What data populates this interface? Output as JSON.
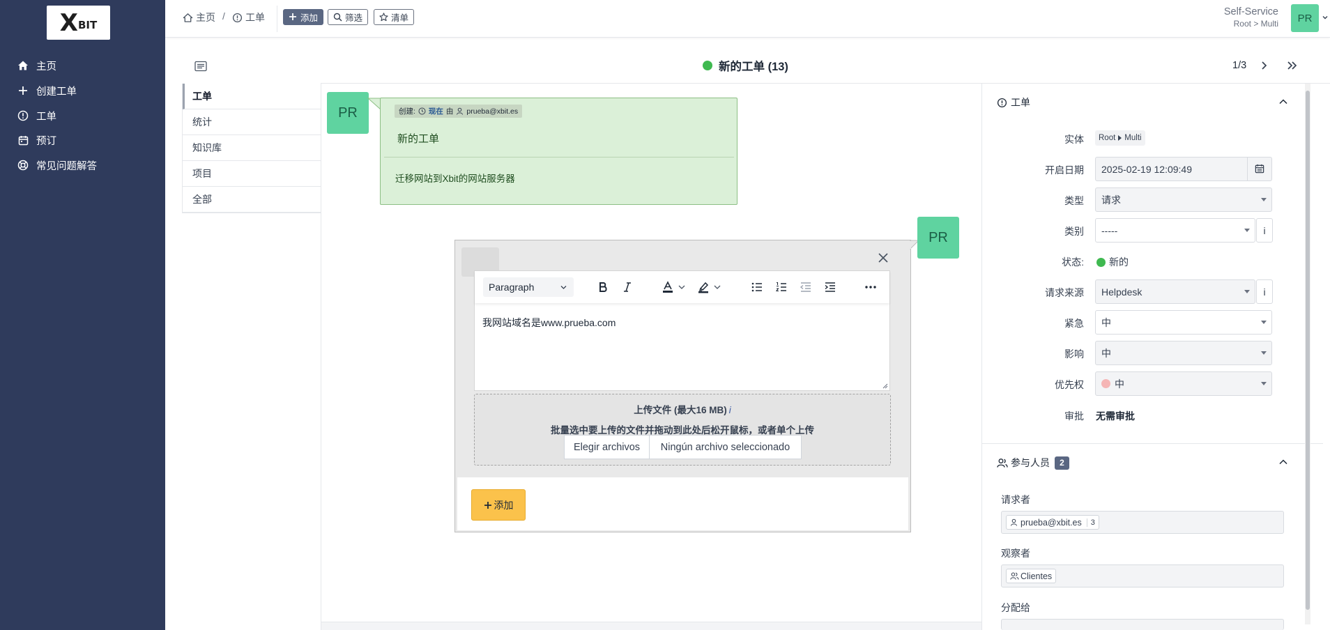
{
  "sidebar": {
    "logo_x": "X",
    "logo_text": "BIT",
    "items": [
      {
        "label": "主页",
        "icon": "home-icon"
      },
      {
        "label": "创建工单",
        "icon": "plus-icon"
      },
      {
        "label": "工单",
        "icon": "ticket-icon"
      },
      {
        "label": "预订",
        "icon": "calendar-icon"
      },
      {
        "label": "常见问题解答",
        "icon": "lifebuoy-icon"
      }
    ]
  },
  "header": {
    "breadcrumb": [
      {
        "label": "主页",
        "icon": "home-icon"
      },
      {
        "label": "工单",
        "icon": "ticket-icon"
      }
    ],
    "separator": "/",
    "buttons": {
      "add": "添加",
      "filter": "筛选",
      "list": "清单"
    },
    "profile": {
      "name": "Self-Service",
      "entity": "Root > Multi",
      "avatar": "PR"
    }
  },
  "ticket": {
    "title": "新的工单 (13)",
    "status_color": "#3fb950",
    "pager": "1/3"
  },
  "tabs": [
    "工单",
    "统计",
    "知识库",
    "项目",
    "全部"
  ],
  "timeline": {
    "avatar": "PR",
    "meta_created": "创建:",
    "meta_when": "现在",
    "meta_by": "由",
    "meta_user": "prueba@xbit.es",
    "title": "新的工单",
    "content": "迁移网站到Xbit的网站服务器"
  },
  "reply": {
    "avatar": "PR",
    "format": "Paragraph",
    "text": "我网站域名是www.prueba.com",
    "upload_title": "上传文件 (最大16 MB)",
    "upload_info": "i",
    "upload_hint": "批量选中要上传的文件并拖动到此处后松开鼠标，或者单个上传",
    "file_button": "Elegir archivos",
    "file_status": "Ningún archivo seleccionado",
    "add_button": "添加"
  },
  "panel": {
    "ticket_section": "工单",
    "fields": {
      "entity_label": "实体",
      "entity_root": "Root",
      "entity_child": "Multi",
      "date_label": "开启日期",
      "date_value": "2025-02-19 12:09:49",
      "type_label": "类型",
      "type_value": "请求",
      "category_label": "类别",
      "category_value": "-----",
      "status_label": "状态:",
      "status_value": "新的",
      "source_label": "请求来源",
      "source_value": "Helpdesk",
      "urgency_label": "紧急",
      "urgency_value": "中",
      "impact_label": "影响",
      "impact_value": "中",
      "priority_label": "优先权",
      "priority_value": "中",
      "approval_label": "审批",
      "approval_value": "无需审批",
      "info": "i"
    },
    "actors_section": "参与人员",
    "actors_count": "2",
    "requester_label": "请求者",
    "requester": "prueba@xbit.es",
    "requester_count": "3",
    "observer_label": "观察者",
    "observer": "Clientes",
    "assigned_label": "分配给"
  },
  "colors": {
    "sidebar": "#2f3b5c",
    "accent": "#5a6782",
    "avatar": "#5fd3a0",
    "bubble": "#dbf0d8",
    "add_button": "#fbc24b"
  }
}
